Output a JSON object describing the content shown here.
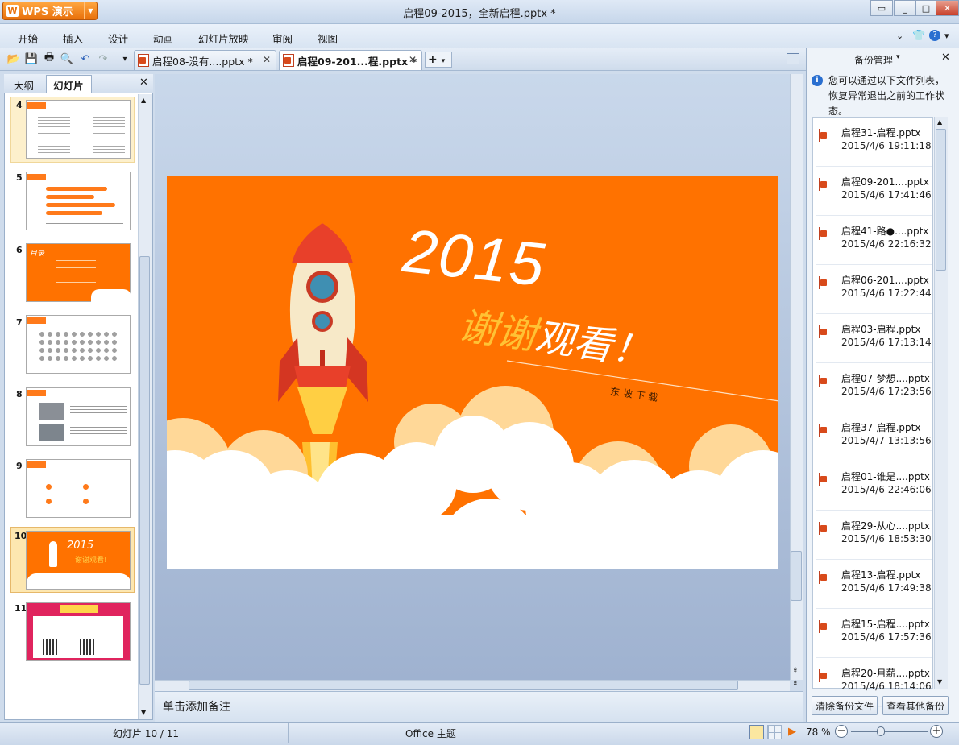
{
  "app": {
    "name": "WPS 演示",
    "title": "启程09-2015，全新启程.pptx *"
  },
  "menu": [
    "开始",
    "插入",
    "设计",
    "动画",
    "幻灯片放映",
    "审阅",
    "视图"
  ],
  "tabs": [
    {
      "label": "启程08-没有....pptx *",
      "active": false
    },
    {
      "label": "启程09-201...程.pptx *",
      "active": true
    }
  ],
  "left_panel": {
    "tabs": [
      "大纲",
      "幻灯片"
    ],
    "active_tab": "幻灯片",
    "slides": [
      "4",
      "5",
      "6",
      "7",
      "8",
      "9",
      "10",
      "11"
    ],
    "selected_slide": "10",
    "thumb_texts": {
      "s6_title": "目录",
      "s10_year": "2015",
      "s10_thanks": "谢谢观看!"
    }
  },
  "slide": {
    "year": "2015",
    "thanks_a": "谢谢",
    "thanks_b": "观看！",
    "author": "东 坡 下 载"
  },
  "notes_placeholder": "单击添加备注",
  "status": {
    "slide_count": "幻灯片 10 / 11",
    "theme": "Office 主题",
    "zoom": "78 %"
  },
  "backup": {
    "title": "备份管理",
    "info": "您可以通过以下文件列表，恢复异常退出之前的工作状态。",
    "items": [
      {
        "name": "启程31-启程.pptx",
        "date": "2015/4/6 19:11:18"
      },
      {
        "name": "启程09-201....pptx",
        "date": "2015/4/6 17:41:46"
      },
      {
        "name": "启程41-路●....pptx",
        "date": "2015/4/6 22:16:32"
      },
      {
        "name": "启程06-201....pptx",
        "date": "2015/4/6 17:22:44"
      },
      {
        "name": "启程03-启程.pptx",
        "date": "2015/4/6 17:13:14"
      },
      {
        "name": "启程07-梦想....pptx",
        "date": "2015/4/6 17:23:56"
      },
      {
        "name": "启程37-启程.pptx",
        "date": "2015/4/7 13:13:56"
      },
      {
        "name": "启程01-谁是....pptx",
        "date": "2015/4/6 22:46:06"
      },
      {
        "name": "启程29-从心....pptx",
        "date": "2015/4/6 18:53:30"
      },
      {
        "name": "启程13-启程.pptx",
        "date": "2015/4/6 17:49:38"
      },
      {
        "name": "启程15-启程....pptx",
        "date": "2015/4/6 17:57:36"
      },
      {
        "name": "启程20-月薪....pptx",
        "date": "2015/4/6 18:14:06"
      }
    ],
    "clear_label": "清除备份文件",
    "view_label": "查看其他备份"
  },
  "colors": {
    "accent": "#ff7200",
    "wps_orange": "#e8700a"
  }
}
